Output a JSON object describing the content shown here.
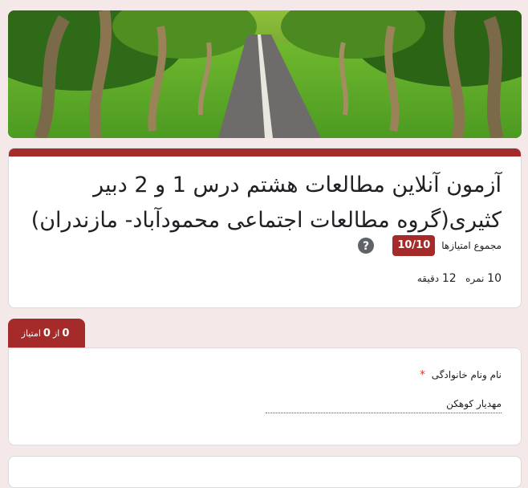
{
  "header": {
    "title": "آزمون آنلاین مطالعات هشتم درس 1 و 2 دبیر کثیری(گروه مطالعات اجتماعی محمودآباد- مازندران)",
    "total_score_label": "مجموع امتیازها",
    "total_score_value": "10/10",
    "points": "10",
    "points_unit": "نمره",
    "minutes": "12",
    "minutes_unit": "دقیقه"
  },
  "section_tab": {
    "earned": "0",
    "of": "از",
    "max": "0",
    "unit": "امتیاز"
  },
  "question": {
    "label": "نام ونام خانوادگی",
    "required_mark": "*",
    "answer": "مهدیار کوهکن"
  },
  "theme": {
    "accent": "#a52a2a",
    "background": "#f5e8e9"
  }
}
